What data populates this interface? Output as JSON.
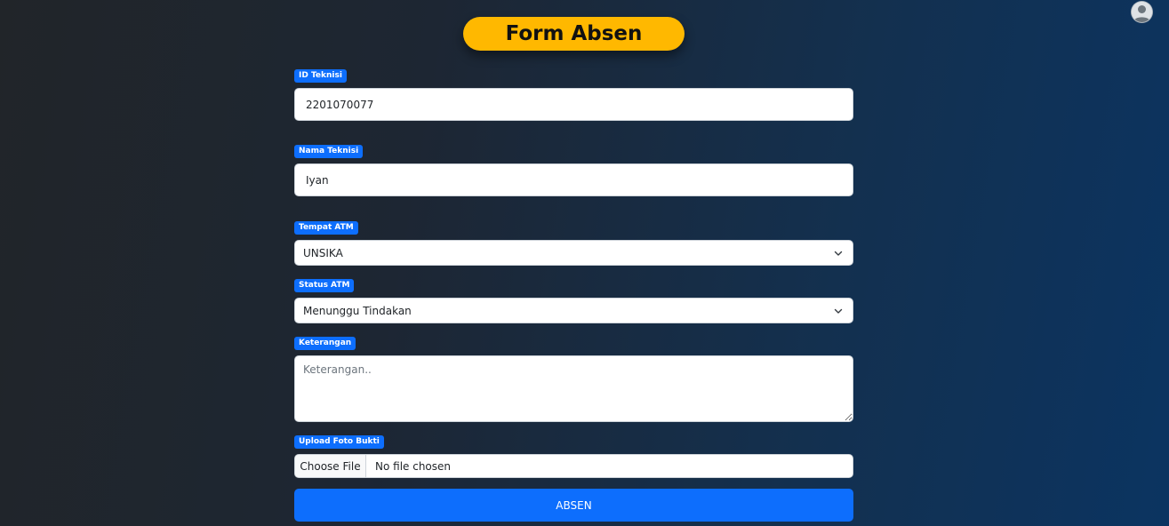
{
  "header": {
    "title": "Form Absen",
    "avatar_icon": "user-avatar-icon"
  },
  "form": {
    "id_teknisi": {
      "label": "ID Teknisi",
      "value": "2201070077"
    },
    "nama_teknisi": {
      "label": "Nama Teknisi",
      "value": "Iyan"
    },
    "tempat_atm": {
      "label": "Tempat ATM",
      "selected": "UNSIKA"
    },
    "status_atm": {
      "label": "Status ATM",
      "selected": "Menunggu Tindakan"
    },
    "keterangan": {
      "label": "Keterangan",
      "placeholder": "Keterangan..",
      "value": ""
    },
    "upload": {
      "label": "Upload Foto Bukti",
      "button": "Choose File",
      "status": "No file chosen"
    },
    "submit_label": "ABSEN"
  },
  "colors": {
    "accent": "#0d6efd",
    "title_pill": "#ffb800"
  }
}
